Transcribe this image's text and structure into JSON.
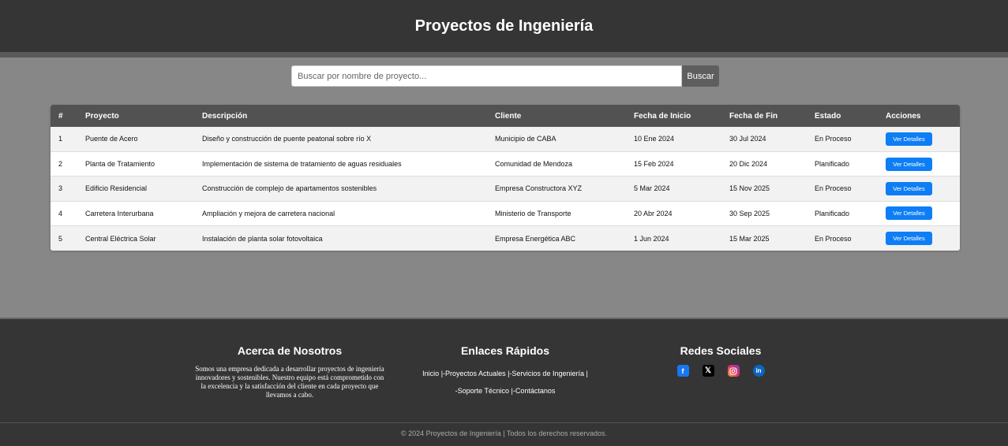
{
  "header": {
    "title": "Proyectos de Ingeniería"
  },
  "search": {
    "placeholder": "Buscar por nombre de proyecto...",
    "button_label": "Buscar"
  },
  "table": {
    "columns": [
      "#",
      "Proyecto",
      "Descripción",
      "Cliente",
      "Fecha de Inicio",
      "Fecha de Fin",
      "Estado",
      "Acciones"
    ],
    "rows": [
      {
        "num": "1",
        "proyecto": "Puente de Acero",
        "descripcion": "Diseño y construcción de puente peatonal sobre río X",
        "cliente": "Municipio de CABA",
        "inicio": "10 Ene 2024",
        "fin": "30 Jul 2024",
        "estado": "En Proceso",
        "accion": "Ver Detalles"
      },
      {
        "num": "2",
        "proyecto": "Planta de Tratamiento",
        "descripcion": "Implementación de sistema de tratamiento de aguas residuales",
        "cliente": "Comunidad de Mendoza",
        "inicio": "15 Feb 2024",
        "fin": "20 Dic 2024",
        "estado": "Planificado",
        "accion": "Ver Detalles"
      },
      {
        "num": "3",
        "proyecto": "Edificio Residencial",
        "descripcion": "Construcción de complejo de apartamentos sostenibles",
        "cliente": "Empresa Constructora XYZ",
        "inicio": "5 Mar 2024",
        "fin": "15 Nov 2025",
        "estado": "En Proceso",
        "accion": "Ver Detalles"
      },
      {
        "num": "4",
        "proyecto": "Carretera Interurbana",
        "descripcion": "Ampliación y mejora de carretera nacional",
        "cliente": "Ministerio de Transporte",
        "inicio": "20 Abr 2024",
        "fin": "30 Sep 2025",
        "estado": "Planificado",
        "accion": "Ver Detalles"
      },
      {
        "num": "5",
        "proyecto": "Central Eléctrica Solar",
        "descripcion": "Instalación de planta solar fotovoltaica",
        "cliente": "Empresa Energética ABC",
        "inicio": "1 Jun 2024",
        "fin": "15 Mar 2025",
        "estado": "En Proceso",
        "accion": "Ver Detalles"
      }
    ]
  },
  "footer": {
    "about": {
      "title": "Acerca de Nosotros",
      "text": "Somos una empresa dedicada a desarrollar proyectos de ingeniería innovadores y sostenibles. Nuestro equipo está comprometido con la excelencia y la satisfacción del cliente en cada proyecto que llevamos a cabo."
    },
    "links": {
      "title": "Enlaces Rápidos",
      "items": [
        "Inicio",
        "Proyectos Actuales",
        "Servicios de Ingeniería",
        "Soporte Técnico",
        "Contáctanos"
      ]
    },
    "social": {
      "title": "Redes Sociales",
      "icons": [
        "facebook-icon",
        "x-icon",
        "instagram-icon",
        "linkedin-icon"
      ]
    },
    "copyright": "© 2024 Proyectos de Ingeniería | Todos los derechos reservados."
  },
  "colors": {
    "header_bg": "#353535",
    "page_bg": "#878787",
    "button_blue": "#0d7ef5",
    "table_header": "#525252"
  }
}
